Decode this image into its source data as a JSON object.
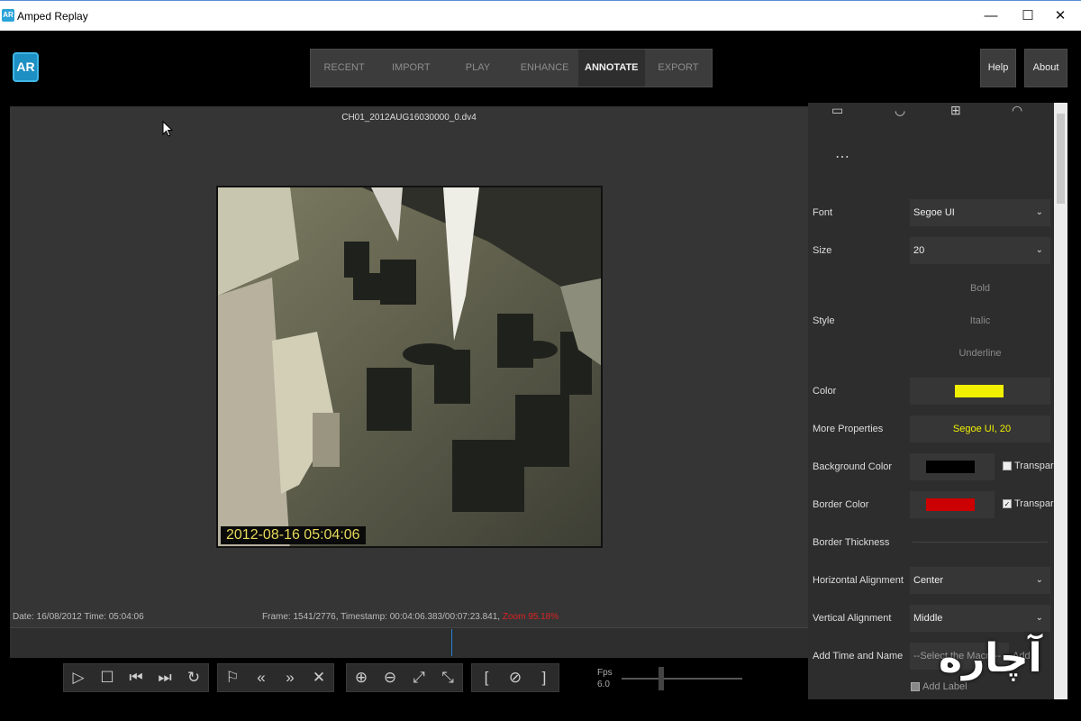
{
  "window": {
    "title": "Amped Replay",
    "app_icon": "AR",
    "minimize": "—",
    "maximize": "☐",
    "close": "✕"
  },
  "app": {
    "logo": "AR",
    "nav": [
      "RECENT",
      "IMPORT",
      "PLAY",
      "ENHANCE",
      "ANNOTATE",
      "EXPORT"
    ],
    "active_tab": "ANNOTATE",
    "help_label": "Help",
    "about_label": "About"
  },
  "viewer": {
    "filename": "CH01_2012AUG16030000_0.dv4",
    "video_timestamp": "2012-08-16 05:04:06",
    "status_left": "Date: 16/08/2012 Time: 05:04:06",
    "status_frame": "Frame: 1541/2776, Timestamp: 00:04:06.383/00:07:23.841,",
    "status_zoom": "Zoom 95.18%"
  },
  "controls": {
    "fps_label": "Fps",
    "fps_value": "6.0",
    "icons": [
      "play-icon",
      "stop-icon",
      "previous-frame-icon",
      "next-frame-icon",
      "loop-icon",
      "bookmark-icon",
      "rewind-icon",
      "fast-forward-icon",
      "clear-icon",
      "zoom-in-icon",
      "zoom-out-icon",
      "fit-icon",
      "actual-size-icon",
      "mark-in-icon",
      "clear-marks-icon",
      "mark-out-icon"
    ]
  },
  "panel": {
    "more_icon": "⋯",
    "font_label": "Font",
    "font_value": "Segoe UI",
    "size_label": "Size",
    "size_value": "20",
    "style_label": "Style",
    "bold": "Bold",
    "italic": "Italic",
    "underline": "Underline",
    "color_label": "Color",
    "color_value": "#f0f000",
    "more_properties_label": "More Properties",
    "more_properties_value": "Segoe UI, 20",
    "background_color_label": "Background Color",
    "background_color_value": "#000000",
    "border_color_label": "Border Color",
    "border_color_value": "#cc0000",
    "transparent_label": "Transpar",
    "bg_transparent_checked": false,
    "border_transparent_checked": true,
    "border_thickness_label": "Border Thickness",
    "h_align_label": "Horizontal Alignment",
    "h_align_value": "Center",
    "v_align_label": "Vertical Alignment",
    "v_align_value": "Middle",
    "add_time_label": "Add Time and Name",
    "add_time_placeholder": "--Select the Macro--",
    "add_label": "Add Label",
    "add_button": "Add"
  },
  "watermark": "آچاره"
}
